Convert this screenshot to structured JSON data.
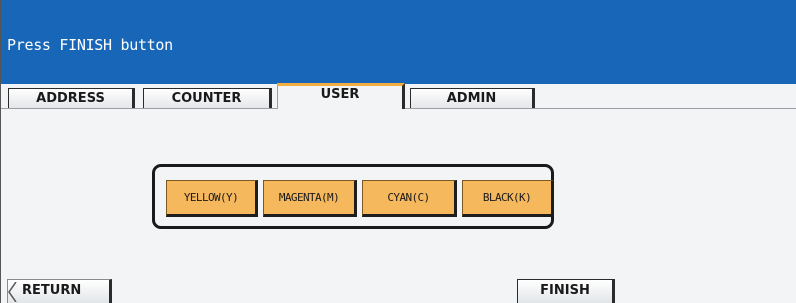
{
  "header": {
    "message": "Press FINISH button",
    "background_color": "#1766b8"
  },
  "tabs": [
    {
      "label": "ADDRESS",
      "active": false
    },
    {
      "label": "COUNTER",
      "active": false
    },
    {
      "label": "USER",
      "active": true
    },
    {
      "label": "ADMIN",
      "active": false
    }
  ],
  "color_selection": {
    "button_color": "#f6b85c",
    "buttons": [
      {
        "label": "YELLOW(Y)"
      },
      {
        "label": "MAGENTA(M)"
      },
      {
        "label": "CYAN(C)"
      },
      {
        "label": "BLACK(K)"
      }
    ]
  },
  "footer": {
    "return_label": "RETURN",
    "return_icon": "left-arrow-icon",
    "finish_label": "FINISH"
  }
}
